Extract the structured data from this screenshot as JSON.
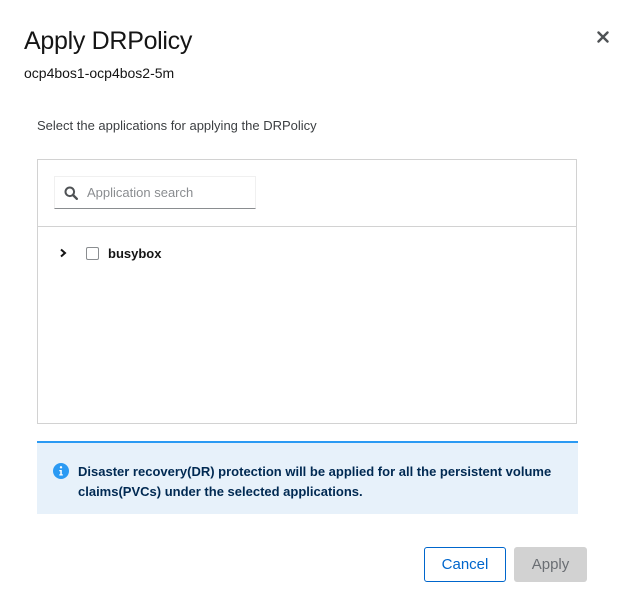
{
  "modal": {
    "title": "Apply DRPolicy",
    "subtitle": "ocp4bos1-ocp4bos2-5m",
    "close_icon": "close-icon",
    "description": "Select the applications for applying the DRPolicy"
  },
  "search": {
    "icon": "search-icon",
    "placeholder": "Application search",
    "value": ""
  },
  "applications": [
    {
      "name": "busybox",
      "checked": false,
      "expanded": false
    }
  ],
  "alert": {
    "icon": "info-icon",
    "text": "Disaster recovery(DR) protection will be applied for all the persistent volume claims(PVCs) under the selected applications.",
    "accent_color": "#2b9af3"
  },
  "footer": {
    "cancel_label": "Cancel",
    "apply_label": "Apply",
    "apply_disabled": true
  }
}
